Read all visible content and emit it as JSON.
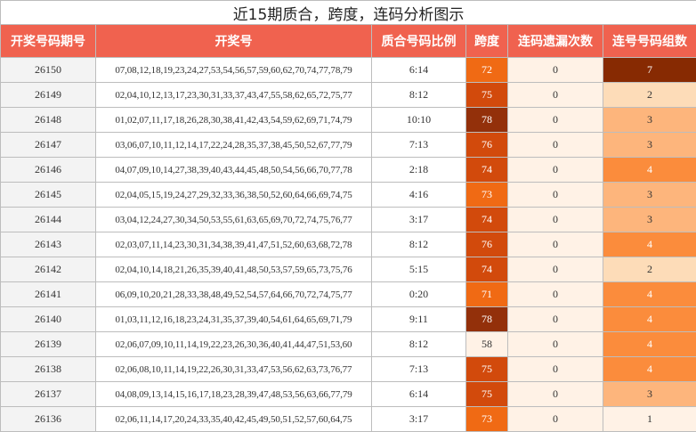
{
  "title": "近15期质合，跨度，连码分析图示",
  "headers": [
    "开奖号码期号",
    "开奖号",
    "质合号码比例",
    "跨度",
    "连码遗漏次数",
    "连号号码组数"
  ],
  "colors": {
    "header_bg": "#f0624f",
    "header_text": "#ffffff",
    "issue_bg": "#f3f3f3",
    "miss_bg": "#fff2e6",
    "span_58": "#fff2e6",
    "span_71_73": "#f06a14",
    "span_74_76": "#d24a0c",
    "span_78": "#93300a",
    "group_1": "#fff2e6",
    "group_2": "#fddcb8",
    "group_3": "#fdb57c",
    "group_4": "#fb8c3c",
    "group_7": "#872a02"
  },
  "rows": [
    {
      "issue": "26150",
      "numbers": "07,08,12,18,19,23,24,27,53,54,56,57,59,60,62,70,74,77,78,79",
      "ratio": "6:14",
      "span": "72",
      "miss": "0",
      "groups": "7"
    },
    {
      "issue": "26149",
      "numbers": "02,04,10,12,13,17,23,30,31,33,37,43,47,55,58,62,65,72,75,77",
      "ratio": "8:12",
      "span": "75",
      "miss": "0",
      "groups": "2"
    },
    {
      "issue": "26148",
      "numbers": "01,02,07,11,17,18,26,28,30,38,41,42,43,54,59,62,69,71,74,79",
      "ratio": "10:10",
      "span": "78",
      "miss": "0",
      "groups": "3"
    },
    {
      "issue": "26147",
      "numbers": "03,06,07,10,11,12,14,17,22,24,28,35,37,38,45,50,52,67,77,79",
      "ratio": "7:13",
      "span": "76",
      "miss": "0",
      "groups": "3"
    },
    {
      "issue": "26146",
      "numbers": "04,07,09,10,14,27,38,39,40,43,44,45,48,50,54,56,66,70,77,78",
      "ratio": "2:18",
      "span": "74",
      "miss": "0",
      "groups": "4"
    },
    {
      "issue": "26145",
      "numbers": "02,04,05,15,19,24,27,29,32,33,36,38,50,52,60,64,66,69,74,75",
      "ratio": "4:16",
      "span": "73",
      "miss": "0",
      "groups": "3"
    },
    {
      "issue": "26144",
      "numbers": "03,04,12,24,27,30,34,50,53,55,61,63,65,69,70,72,74,75,76,77",
      "ratio": "3:17",
      "span": "74",
      "miss": "0",
      "groups": "3"
    },
    {
      "issue": "26143",
      "numbers": "02,03,07,11,14,23,30,31,34,38,39,41,47,51,52,60,63,68,72,78",
      "ratio": "8:12",
      "span": "76",
      "miss": "0",
      "groups": "4"
    },
    {
      "issue": "26142",
      "numbers": "02,04,10,14,18,21,26,35,39,40,41,48,50,53,57,59,65,73,75,76",
      "ratio": "5:15",
      "span": "74",
      "miss": "0",
      "groups": "2"
    },
    {
      "issue": "26141",
      "numbers": "06,09,10,20,21,28,33,38,48,49,52,54,57,64,66,70,72,74,75,77",
      "ratio": "0:20",
      "span": "71",
      "miss": "0",
      "groups": "4"
    },
    {
      "issue": "26140",
      "numbers": "01,03,11,12,16,18,23,24,31,35,37,39,40,54,61,64,65,69,71,79",
      "ratio": "9:11",
      "span": "78",
      "miss": "0",
      "groups": "4"
    },
    {
      "issue": "26139",
      "numbers": "02,06,07,09,10,11,14,19,22,23,26,30,36,40,41,44,47,51,53,60",
      "ratio": "8:12",
      "span": "58",
      "miss": "0",
      "groups": "4"
    },
    {
      "issue": "26138",
      "numbers": "02,06,08,10,11,14,19,22,26,30,31,33,47,53,56,62,63,73,76,77",
      "ratio": "7:13",
      "span": "75",
      "miss": "0",
      "groups": "4"
    },
    {
      "issue": "26137",
      "numbers": "04,08,09,13,14,15,16,17,18,23,28,39,47,48,53,56,63,66,77,79",
      "ratio": "6:14",
      "span": "75",
      "miss": "0",
      "groups": "3"
    },
    {
      "issue": "26136",
      "numbers": "02,06,11,14,17,20,24,33,35,40,42,45,49,50,51,52,57,60,64,75",
      "ratio": "3:17",
      "span": "73",
      "miss": "0",
      "groups": "1"
    }
  ]
}
